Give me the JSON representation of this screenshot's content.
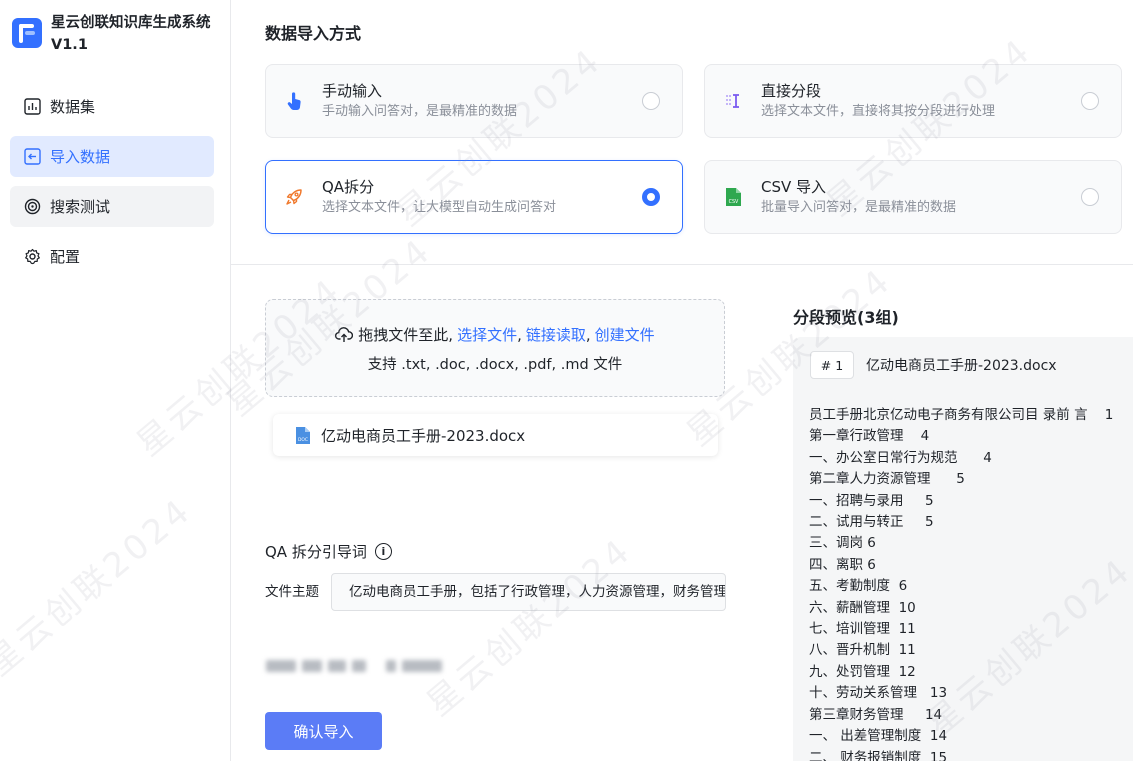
{
  "app": {
    "title": "星云创联知识库生成系统V1.1"
  },
  "sidebar": {
    "items": [
      {
        "label": "数据集",
        "icon": "bar-chart-icon"
      },
      {
        "label": "导入数据",
        "icon": "import-icon"
      },
      {
        "label": "搜索测试",
        "icon": "target-icon"
      },
      {
        "label": "配置",
        "icon": "gear-icon"
      }
    ]
  },
  "import_methods": {
    "title": "数据导入方式",
    "options": [
      {
        "name": "手动输入",
        "desc": "手动输入问答对，是最精准的数据",
        "icon": "hand-pointer-icon",
        "selected": false
      },
      {
        "name": "直接分段",
        "desc": "选择文本文件，直接将其按分段进行处理",
        "icon": "text-cursor-icon",
        "selected": false
      },
      {
        "name": "QA拆分",
        "desc": "选择文本文件，让大模型自动生成问答对",
        "icon": "rocket-icon",
        "selected": true
      },
      {
        "name": "CSV 导入",
        "desc": "批量导入问答对，是最精准的数据",
        "icon": "csv-file-icon",
        "selected": false
      }
    ]
  },
  "upload": {
    "prefix": "拖拽文件至此,",
    "link_select": "选择文件",
    "link_fetch": "链接读取",
    "link_create": "创建文件",
    "sep": ",",
    "support": "支持 .txt, .doc, .docx, .pdf, .md 文件"
  },
  "file": {
    "name": "亿动电商员工手册-2023.docx",
    "icon_label": "DOC"
  },
  "qa": {
    "title": "QA 拆分引导词",
    "info_glyph": "i",
    "field_label": "文件主题",
    "field_value": "亿动电商员工手册，包括了行政管理，人力资源管理，财务管理"
  },
  "confirm_label": "确认导入",
  "preview": {
    "title": "分段预览(3组)",
    "chunk_index": "# 1",
    "chunk_file": "亿动电商员工手册-2023.docx",
    "lines": [
      "员工手册北京亿动电子商务有限公司目 录前 言    1",
      "第一章行政管理    4",
      "一、办公室日常行为规范      4",
      "第二章人力资源管理      5",
      "一、招聘与录用     5",
      "二、试用与转正     5",
      "三、调岗 6",
      "四、离职 6",
      "五、考勤制度  6",
      "六、薪酬管理  10",
      "七、培训管理  11",
      "八、晋升机制  11",
      "九、处罚管理  12",
      "十、劳动关系管理   13",
      "第三章财务管理     14",
      "一、 出差管理制度  14",
      "二、 财务报销制度  15"
    ]
  },
  "watermark": "星云创联2024",
  "colors": {
    "accent": "#3370ff",
    "button": "#5b7cf6",
    "active_nav_bg": "#e1eaff",
    "rocket": "#f0792d",
    "csv": "#2fa84f",
    "split_icon": "#7b5cf0"
  }
}
